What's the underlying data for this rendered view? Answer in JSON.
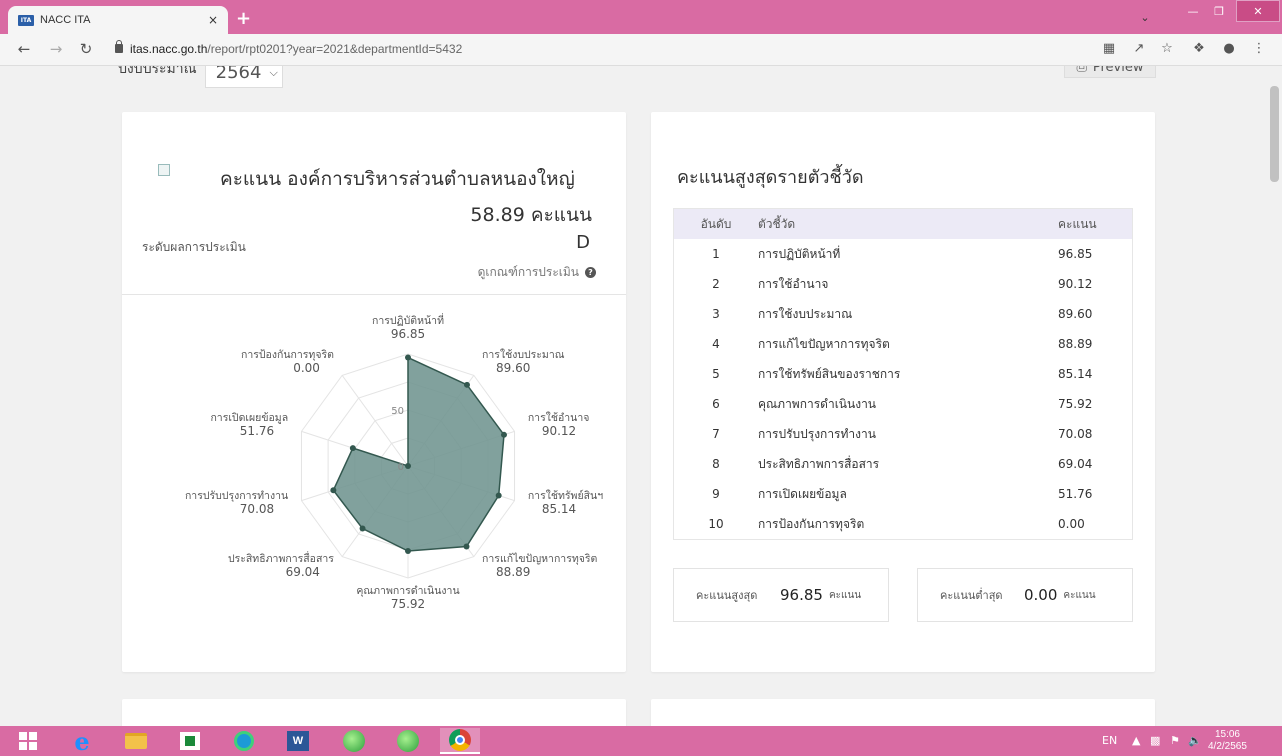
{
  "browser": {
    "tab_title": "NACC ITA",
    "tab_favicon": "ITA",
    "tab_close": "×",
    "new_tab": "+",
    "url_host": "itas.nacc.go.th",
    "url_path": "/report/rpt0201?year=2021&departmentId=5432"
  },
  "page": {
    "budget_label": "ปีงบประมาณ",
    "budget_year": "2564",
    "preview_label": "Preview"
  },
  "score_card": {
    "title": "คะแนน องค์การบริหารส่วนตำบลหนองใหญ่",
    "total_score": "58.89 คะแนน",
    "level_label": "ระดับผลการประเมิน",
    "level_value": "D",
    "criteria_link": "ดูเกณฑ์การประเมิน",
    "help_glyph": "?"
  },
  "chart_data": {
    "type": "radar",
    "axes": [
      "การปฏิบัติหน้าที่",
      "การใช้งบประมาณ",
      "การใช้อำนาจ",
      "การใช้ทรัพย์สินฯ",
      "การแก้ไขปัญหาการทุจริต",
      "คุณภาพการดำเนินงาน",
      "ประสิทธิภาพการสื่อสาร",
      "การปรับปรุงการทำงาน",
      "การเปิดเผยข้อมูล",
      "การป้องกันการทุจริต"
    ],
    "values": [
      96.85,
      89.6,
      90.12,
      85.14,
      88.89,
      75.92,
      69.04,
      70.08,
      51.76,
      0.0
    ],
    "value_labels": [
      "96.85",
      "89.60",
      "90.12",
      "85.14",
      "88.89",
      "75.92",
      "69.04",
      "70.08",
      "51.76",
      "0.00"
    ],
    "range": [
      0,
      100
    ],
    "tick_labels": [
      "0",
      "50"
    ],
    "fill_color": "#6f948f",
    "line_color": "#33584f"
  },
  "ranking": {
    "title": "คะแนนสูงสุดรายตัวชี้วัด",
    "headers": {
      "rank": "อันดับ",
      "indicator": "ตัวชี้วัด",
      "score": "คะแนน"
    },
    "rows": [
      {
        "rank": "1",
        "indicator": "การปฏิบัติหน้าที่",
        "score": "96.85"
      },
      {
        "rank": "2",
        "indicator": "การใช้อำนาจ",
        "score": "90.12"
      },
      {
        "rank": "3",
        "indicator": "การใช้งบประมาณ",
        "score": "89.60"
      },
      {
        "rank": "4",
        "indicator": "การแก้ไขปัญหาการทุจริต",
        "score": "88.89"
      },
      {
        "rank": "5",
        "indicator": "การใช้ทรัพย์สินของราชการ",
        "score": "85.14"
      },
      {
        "rank": "6",
        "indicator": "คุณภาพการดำเนินงาน",
        "score": "75.92"
      },
      {
        "rank": "7",
        "indicator": "การปรับปรุงการทำงาน",
        "score": "70.08"
      },
      {
        "rank": "8",
        "indicator": "ประสิทธิภาพการสื่อสาร",
        "score": "69.04"
      },
      {
        "rank": "9",
        "indicator": "การเปิดเผยข้อมูล",
        "score": "51.76"
      },
      {
        "rank": "10",
        "indicator": "การป้องกันการทุจริต",
        "score": "0.00"
      }
    ],
    "max_label": "คะแนนสูงสุด",
    "max_value": "96.85",
    "min_label": "คะแนนต่ำสุด",
    "min_value": "0.00",
    "unit": "คะแนน"
  },
  "taskbar": {
    "lang": "EN",
    "time": "15:06",
    "date": "4/2/2565",
    "word_label": "W"
  }
}
